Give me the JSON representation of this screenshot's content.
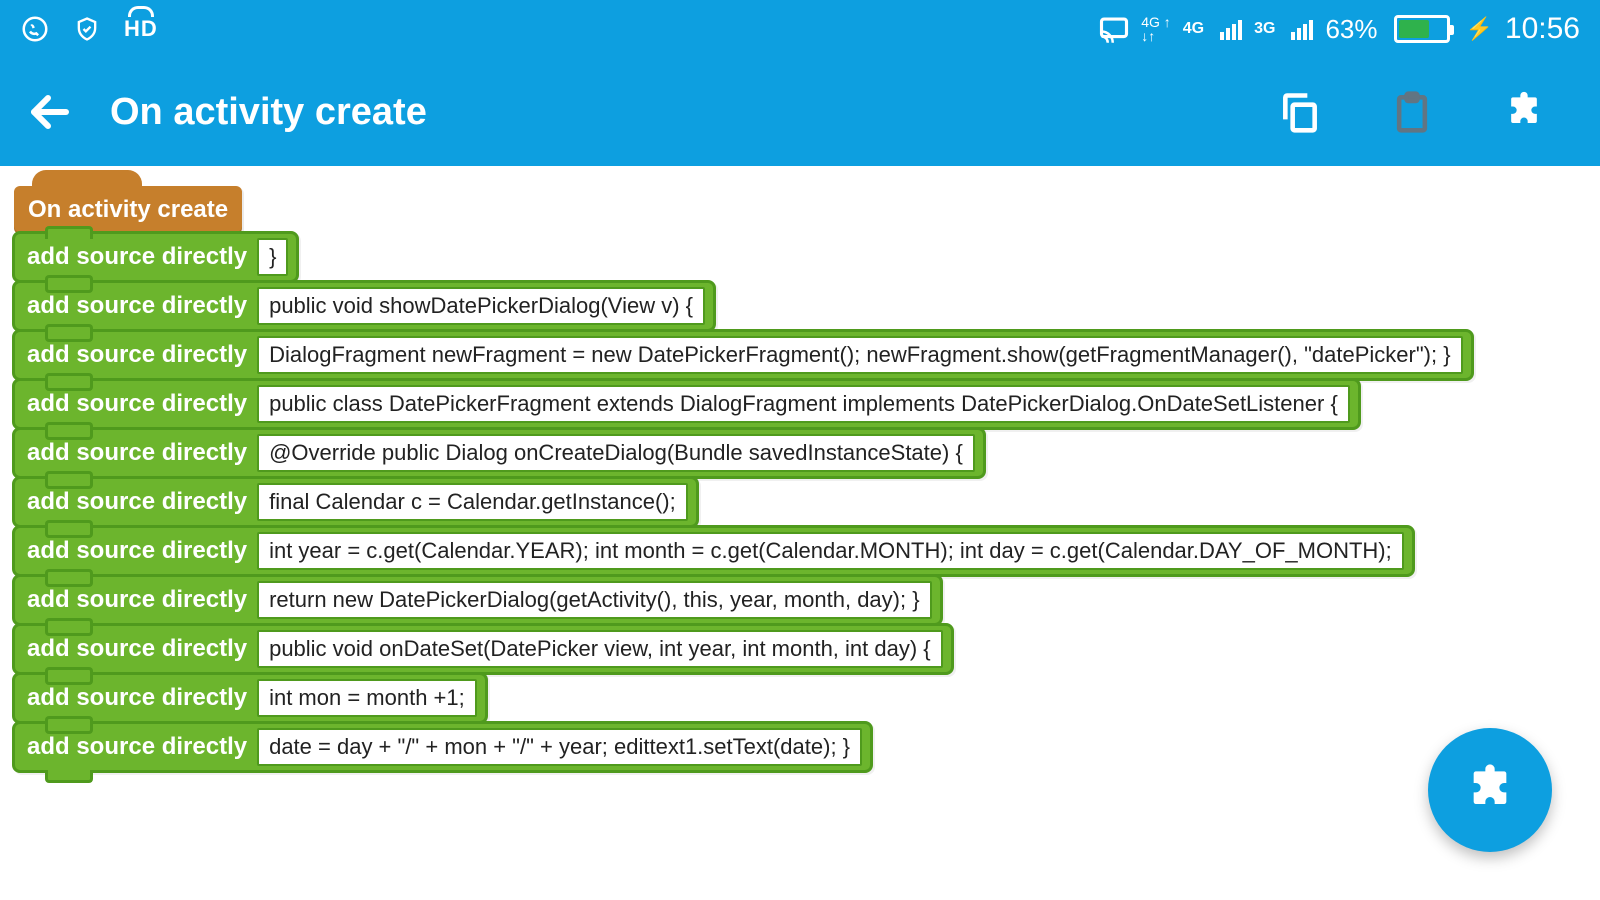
{
  "status": {
    "hd": "HD",
    "net_label_4g": "4G",
    "net_label_3g": "3G",
    "battery_pct": "63%",
    "battery_fill_pct": 63,
    "time": "10:56"
  },
  "appbar": {
    "title": "On activity create"
  },
  "hat": {
    "label": "On activity create"
  },
  "block_label": "add source directly",
  "blocks": [
    {
      "code": "}"
    },
    {
      "code": "public void showDatePickerDialog(View v) {"
    },
    {
      "code": "DialogFragment newFragment = new DatePickerFragment();  newFragment.show(getFragmentManager(), \"datePicker\"); }"
    },
    {
      "code": "public class DatePickerFragment extends DialogFragment implements DatePickerDialog.OnDateSetListener {"
    },
    {
      "code": "@Override public Dialog onCreateDialog(Bundle savedInstanceState) {"
    },
    {
      "code": "final Calendar c = Calendar.getInstance();"
    },
    {
      "code": "int year = c.get(Calendar.YEAR); int month = c.get(Calendar.MONTH); int day = c.get(Calendar.DAY_OF_MONTH);"
    },
    {
      "code": "return new DatePickerDialog(getActivity(), this, year, month, day); }"
    },
    {
      "code": "public void onDateSet(DatePicker view, int year, int month, int day) {"
    },
    {
      "code": "int mon = month +1;"
    },
    {
      "code": "date = day + \"/\" + mon + \"/\" + year; edittext1.setText(date); }"
    }
  ]
}
